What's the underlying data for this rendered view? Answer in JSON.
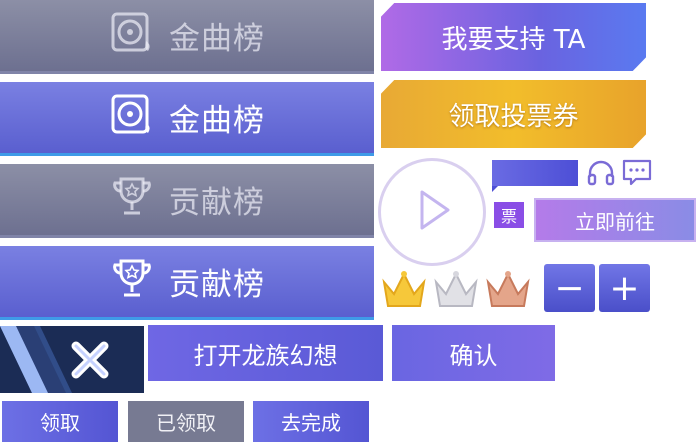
{
  "tabs": [
    {
      "label": "金曲榜",
      "icon": "vinyl-disc-icon",
      "state": "inactive"
    },
    {
      "label": "金曲榜",
      "icon": "vinyl-disc-icon",
      "state": "active"
    },
    {
      "label": "贡献榜",
      "icon": "trophy-icon",
      "state": "inactive"
    },
    {
      "label": "贡献榜",
      "icon": "trophy-icon",
      "state": "active"
    }
  ],
  "buttons": {
    "support": "我要支持 TA",
    "vote_ticket": "领取投票券",
    "ticket_badge": "票",
    "go_now": "立即前往",
    "open_game": "打开龙族幻想",
    "confirm": "确认",
    "claim": "领取",
    "claimed": "已领取",
    "do_task": "去完成",
    "minus": "−",
    "plus": "+"
  },
  "colors": {
    "accent_purple": "#6a63e0",
    "gold": "#f2bd2b",
    "gray_tab": "#7f8299"
  }
}
